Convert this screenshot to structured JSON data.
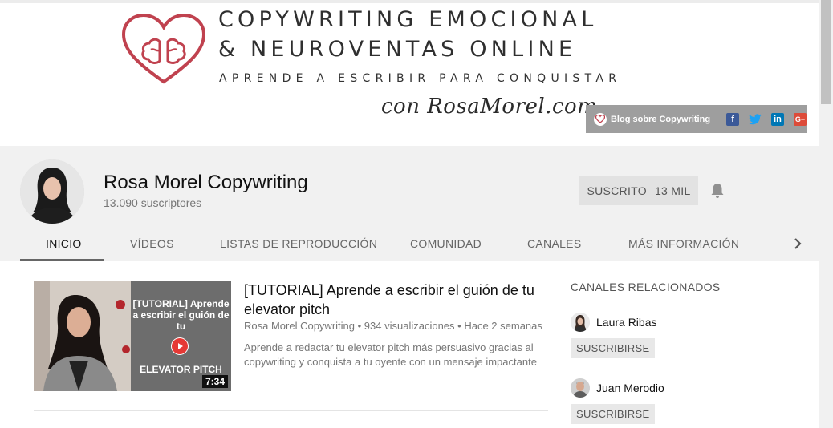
{
  "banner": {
    "line1": "COPYWRITING EMOCIONAL",
    "line2": "& NEUROVENTAS ONLINE",
    "line3": "APRENDE A ESCRIBIR PARA CONQUISTAR",
    "signature": "con RosaMorel.com",
    "blog_link": "Blog sobre Copywriting",
    "social": {
      "facebook": "f",
      "twitter": "t",
      "linkedin": "in",
      "googleplus": "G+"
    },
    "brand_color": "#c0424f"
  },
  "channel": {
    "name": "Rosa Morel Copywriting",
    "subscribers": "13.090 suscriptores",
    "subscribe_label": "SUSCRITO",
    "subscribe_count": "13 MIL"
  },
  "tabs": [
    {
      "label": "INICIO",
      "active": true
    },
    {
      "label": "VÍDEOS"
    },
    {
      "label": "LISTAS DE REPRODUCCIÓN"
    },
    {
      "label": "COMUNIDAD"
    },
    {
      "label": "CANALES"
    },
    {
      "label": "MÁS INFORMACIÓN"
    }
  ],
  "featured_video": {
    "thumb_text": "[TUTORIAL] Aprende a escribir el guión de tu",
    "thumb_bottom": "ELEVATOR PITCH",
    "duration": "7:34",
    "title": "[TUTORIAL] Aprende a escribir el guión de tu elevator pitch",
    "channel": "Rosa Morel Copywriting",
    "views": "934 visualizaciones",
    "age": "Hace 2 semanas",
    "description": "Aprende a redactar tu elevator pitch más persuasivo gracias al copywriting y conquista a tu oyente con un mensaje impactante"
  },
  "related": {
    "heading": "CANALES RELACIONADOS",
    "channels": [
      {
        "name": "Laura Ribas",
        "button": "SUSCRIBIRSE"
      },
      {
        "name": "Juan Merodio",
        "button": "SUSCRIBIRSE"
      }
    ]
  }
}
